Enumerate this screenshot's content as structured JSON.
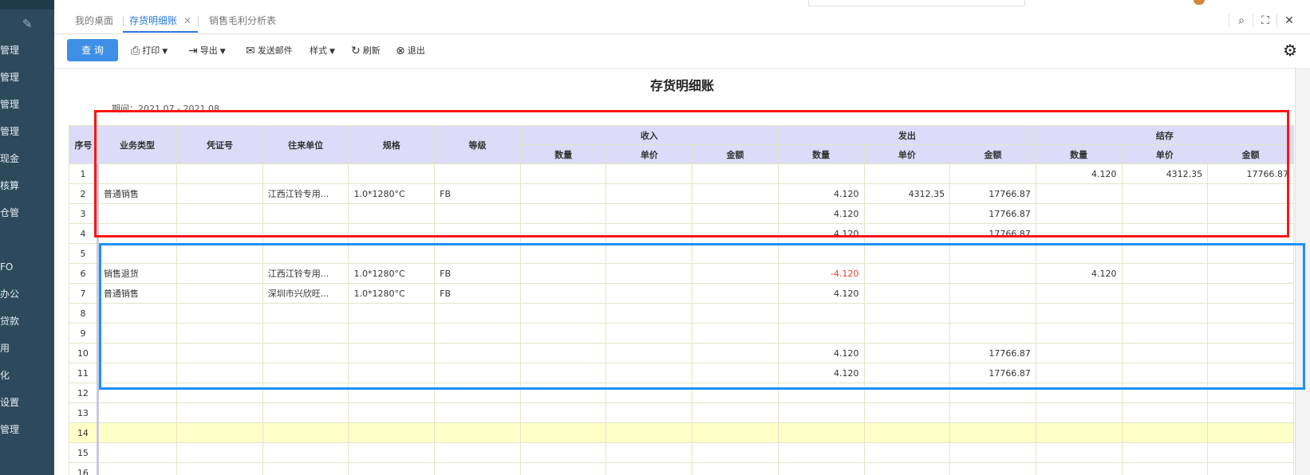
{
  "sidebar": {
    "items": [
      "管理",
      "管理",
      "管理",
      "管理",
      "现金",
      "核算",
      "仓管",
      "FO",
      "办公",
      "贷款",
      "用",
      "化",
      "设置",
      "管理"
    ]
  },
  "tabs": [
    {
      "label": "我的桌面"
    },
    {
      "label": "存货明细账",
      "active": true
    },
    {
      "label": "销售毛利分析表"
    }
  ],
  "toolbar": {
    "query": "查 询",
    "print": "打印",
    "export": "导出",
    "email": "发送邮件",
    "style": "样式",
    "refresh": "刷新",
    "exit": "退出"
  },
  "report": {
    "title": "存货明细账",
    "period": "期间：2021.07 - 2021.08"
  },
  "table": {
    "headers": {
      "seq": "序号",
      "biz_type": "业务类型",
      "voucher": "凭证号",
      "partner": "往来单位",
      "spec": "规格",
      "grade": "等级",
      "income": "收入",
      "outgo": "发出",
      "balance": "结存",
      "qty": "数量",
      "price": "单价",
      "amount": "金额"
    },
    "rows": [
      {
        "seq": "1",
        "biz": "",
        "voucher": "",
        "partner": "",
        "spec": "",
        "grade": "",
        "in_qty": "",
        "in_price": "",
        "in_amt": "",
        "out_qty": "",
        "out_price": "",
        "out_amt": "",
        "bal_qty": "4.120",
        "bal_price": "4312.35",
        "bal_amt": "17766.87"
      },
      {
        "seq": "2",
        "biz": "普通销售",
        "voucher": "",
        "partner": "江西江铃专用...",
        "spec": "1.0*1280°C",
        "grade": "FB",
        "in_qty": "",
        "in_price": "",
        "in_amt": "",
        "out_qty": "4.120",
        "out_price": "4312.35",
        "out_amt": "17766.87",
        "bal_qty": "",
        "bal_price": "",
        "bal_amt": ""
      },
      {
        "seq": "3",
        "biz": "",
        "voucher": "",
        "partner": "",
        "spec": "",
        "grade": "",
        "in_qty": "",
        "in_price": "",
        "in_amt": "",
        "out_qty": "4.120",
        "out_price": "",
        "out_amt": "17766.87",
        "bal_qty": "",
        "bal_price": "",
        "bal_amt": ""
      },
      {
        "seq": "4",
        "biz": "",
        "voucher": "",
        "partner": "",
        "spec": "",
        "grade": "",
        "in_qty": "",
        "in_price": "",
        "in_amt": "",
        "out_qty": "4.120",
        "out_price": "",
        "out_amt": "17766.87",
        "bal_qty": "",
        "bal_price": "",
        "bal_amt": ""
      },
      {
        "seq": "5",
        "biz": "",
        "voucher": "",
        "partner": "",
        "spec": "",
        "grade": "",
        "in_qty": "",
        "in_price": "",
        "in_amt": "",
        "out_qty": "",
        "out_price": "",
        "out_amt": "",
        "bal_qty": "",
        "bal_price": "",
        "bal_amt": ""
      },
      {
        "seq": "6",
        "biz": "销售退货",
        "voucher": "",
        "partner": "江西江铃专用...",
        "spec": "1.0*1280°C",
        "grade": "FB",
        "in_qty": "",
        "in_price": "",
        "in_amt": "",
        "out_qty": "-4.120",
        "out_price": "",
        "out_amt": "",
        "bal_qty": "4.120",
        "bal_price": "",
        "bal_amt": "",
        "out_qty_neg": true
      },
      {
        "seq": "7",
        "biz": "普通销售",
        "voucher": "",
        "partner": "深圳市兴欣旺...",
        "spec": "1.0*1280°C",
        "grade": "FB",
        "in_qty": "",
        "in_price": "",
        "in_amt": "",
        "out_qty": "4.120",
        "out_price": "",
        "out_amt": "",
        "bal_qty": "",
        "bal_price": "",
        "bal_amt": ""
      },
      {
        "seq": "8",
        "biz": "",
        "voucher": "",
        "partner": "",
        "spec": "",
        "grade": "",
        "in_qty": "",
        "in_price": "",
        "in_amt": "",
        "out_qty": "",
        "out_price": "",
        "out_amt": "",
        "bal_qty": "",
        "bal_price": "",
        "bal_amt": ""
      },
      {
        "seq": "9",
        "biz": "",
        "voucher": "",
        "partner": "",
        "spec": "",
        "grade": "",
        "in_qty": "",
        "in_price": "",
        "in_amt": "",
        "out_qty": "",
        "out_price": "",
        "out_amt": "",
        "bal_qty": "",
        "bal_price": "",
        "bal_amt": ""
      },
      {
        "seq": "10",
        "biz": "",
        "voucher": "",
        "partner": "",
        "spec": "",
        "grade": "",
        "in_qty": "",
        "in_price": "",
        "in_amt": "",
        "out_qty": "4.120",
        "out_price": "",
        "out_amt": "17766.87",
        "bal_qty": "",
        "bal_price": "",
        "bal_amt": ""
      },
      {
        "seq": "11",
        "biz": "",
        "voucher": "",
        "partner": "",
        "spec": "",
        "grade": "",
        "in_qty": "",
        "in_price": "",
        "in_amt": "",
        "out_qty": "4.120",
        "out_price": "",
        "out_amt": "17766.87",
        "bal_qty": "",
        "bal_price": "",
        "bal_amt": ""
      },
      {
        "seq": "12",
        "biz": "",
        "voucher": "",
        "partner": "",
        "spec": "",
        "grade": "",
        "in_qty": "",
        "in_price": "",
        "in_amt": "",
        "out_qty": "",
        "out_price": "",
        "out_amt": "",
        "bal_qty": "",
        "bal_price": "",
        "bal_amt": ""
      },
      {
        "seq": "13",
        "biz": "",
        "voucher": "",
        "partner": "",
        "spec": "",
        "grade": "",
        "in_qty": "",
        "in_price": "",
        "in_amt": "",
        "out_qty": "",
        "out_price": "",
        "out_amt": "",
        "bal_qty": "",
        "bal_price": "",
        "bal_amt": ""
      },
      {
        "seq": "14",
        "biz": "",
        "voucher": "",
        "partner": "",
        "spec": "",
        "grade": "",
        "in_qty": "",
        "in_price": "",
        "in_amt": "",
        "out_qty": "",
        "out_price": "",
        "out_amt": "",
        "bal_qty": "",
        "bal_price": "",
        "bal_amt": "",
        "highlight": true
      },
      {
        "seq": "15",
        "biz": "",
        "voucher": "",
        "partner": "",
        "spec": "",
        "grade": "",
        "in_qty": "",
        "in_price": "",
        "in_amt": "",
        "out_qty": "",
        "out_price": "",
        "out_amt": "",
        "bal_qty": "",
        "bal_price": "",
        "bal_amt": ""
      },
      {
        "seq": "16",
        "biz": "",
        "voucher": "",
        "partner": "",
        "spec": "",
        "grade": "",
        "in_qty": "",
        "in_price": "",
        "in_amt": "",
        "out_qty": "",
        "out_price": "",
        "out_amt": "",
        "bal_qty": "",
        "bal_price": "",
        "bal_amt": ""
      }
    ]
  },
  "colors": {
    "sidebar": "#2c4a5c",
    "accent": "#2a78d8",
    "query_button": "#3f8fe6",
    "header_bg": "#dcdcf8",
    "highlight_row": "#ffffc8",
    "negative": "#e53935",
    "annotation_red": "#ff1515",
    "annotation_blue": "#1e90ff"
  },
  "icons": {
    "print": "printer-icon",
    "export": "export-icon",
    "email": "mail-icon",
    "refresh": "refresh-icon",
    "exit": "exit-icon",
    "settings": "gear-icon",
    "search": "search-icon",
    "fullscreen": "fullscreen-icon",
    "close": "close-icon"
  }
}
